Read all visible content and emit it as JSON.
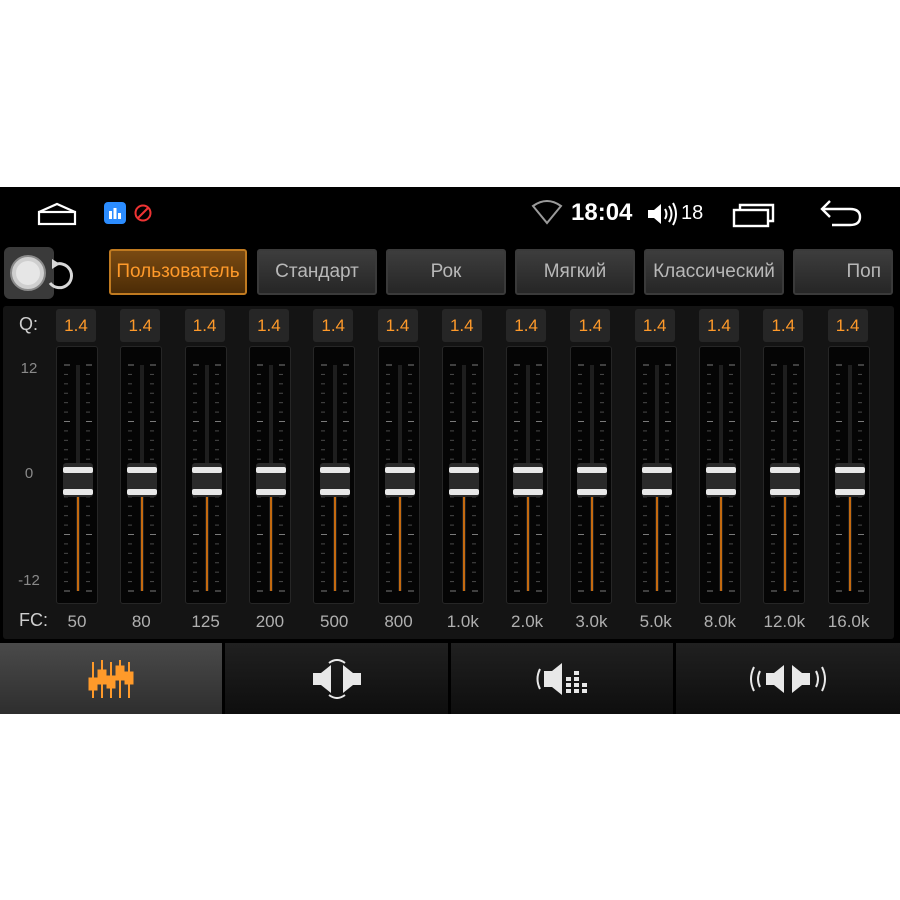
{
  "status_bar": {
    "time": "18:04",
    "volume_level": "18",
    "icons": [
      "home-icon",
      "app-badge-icon",
      "blocked-icon",
      "wifi-icon",
      "volume-icon",
      "recents-icon",
      "back-icon"
    ]
  },
  "presets": [
    {
      "label": "Пользователь",
      "active": true
    },
    {
      "label": "Стандарт",
      "active": false
    },
    {
      "label": "Рок",
      "active": false
    },
    {
      "label": "Мягкий",
      "active": false
    },
    {
      "label": "Классический",
      "active": false
    },
    {
      "label": "Поп",
      "active": false
    }
  ],
  "eq": {
    "q_label": "Q:",
    "fc_label": "FC:",
    "scale": {
      "max": "12",
      "mid": "0",
      "min": "-12"
    },
    "gain_range": [
      -12,
      12
    ],
    "bands": [
      {
        "q": "1.4",
        "fc": "50",
        "gain": 0
      },
      {
        "q": "1.4",
        "fc": "80",
        "gain": 0
      },
      {
        "q": "1.4",
        "fc": "125",
        "gain": 0
      },
      {
        "q": "1.4",
        "fc": "200",
        "gain": 0
      },
      {
        "q": "1.4",
        "fc": "500",
        "gain": 0
      },
      {
        "q": "1.4",
        "fc": "800",
        "gain": 0
      },
      {
        "q": "1.4",
        "fc": "1.0k",
        "gain": 0
      },
      {
        "q": "1.4",
        "fc": "2.0k",
        "gain": 0
      },
      {
        "q": "1.4",
        "fc": "3.0k",
        "gain": 0
      },
      {
        "q": "1.4",
        "fc": "5.0k",
        "gain": 0
      },
      {
        "q": "1.4",
        "fc": "8.0k",
        "gain": 0
      },
      {
        "q": "1.4",
        "fc": "12.0k",
        "gain": 0
      },
      {
        "q": "1.4",
        "fc": "16.0k",
        "gain": 0
      }
    ]
  },
  "tabs": [
    {
      "icon": "equalizer-icon",
      "active": true
    },
    {
      "icon": "speaker-balance-icon",
      "active": false
    },
    {
      "icon": "subwoofer-icon",
      "active": false
    },
    {
      "icon": "surround-sound-icon",
      "active": false
    }
  ],
  "colors": {
    "accent": "#ff9a2a",
    "accent_dark": "#c46a10",
    "background": "#000000"
  }
}
